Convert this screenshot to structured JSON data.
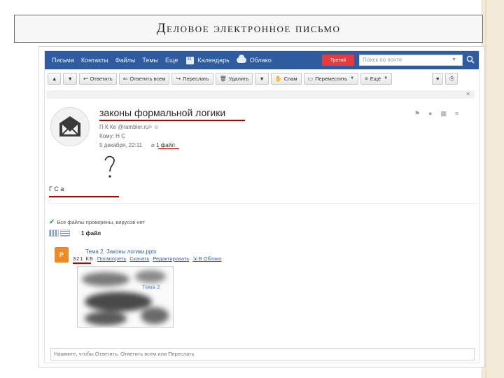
{
  "slide": {
    "title": "Деловое электронное письмо"
  },
  "topbar": {
    "nav": [
      "Письма",
      "Контакты",
      "Файлы",
      "Темы",
      "Еще"
    ],
    "calendar": "Календарь",
    "cloud": "Облако",
    "red_button": "Третий",
    "search_placeholder": "Поиск по почте"
  },
  "toolbar": {
    "reply": "Ответить",
    "reply_all": "Ответить всем",
    "forward": "Переслать",
    "delete": "Удалить",
    "spam": "Спам",
    "move": "Переместить",
    "more": "Ещё"
  },
  "email": {
    "subject": "законы формальной логики",
    "from_line": "П        К           Ке         @rambler.ru> ☺",
    "to_line": "Кому: Н         С",
    "date": "5 декабря, 22:11",
    "attachments_link": "1 файл",
    "body_text": "Г        С        а"
  },
  "attachments": {
    "checked_text": "Все файлы проверены, вирусов нет",
    "count_label": "1 файл",
    "file_name": "Тема 2. Законы логики.pptx",
    "size": "321 КБ",
    "actions": [
      "Посмотреть",
      "Скачать",
      "Редактировать",
      "В Облако"
    ],
    "thumb_caption": "Тема 2"
  },
  "reply_bar": {
    "text": "Нажмите, чтобы Ответить, Ответить всем или Переслать"
  },
  "colors": {
    "topbar": "#2f5c9e",
    "accent_red": "#b30000",
    "link": "#3465a4",
    "ppt": "#f08a23",
    "check": "#2e9e3e"
  }
}
